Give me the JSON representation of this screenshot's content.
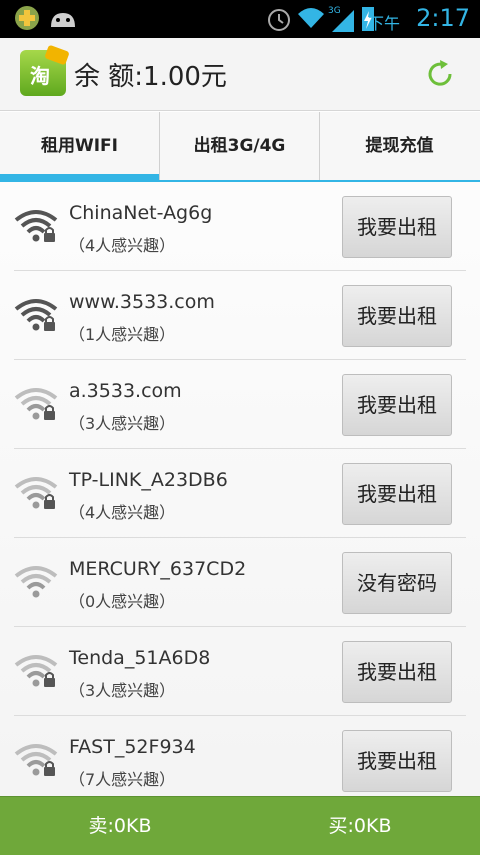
{
  "status_bar": {
    "ampm": "下午",
    "time": "2:17",
    "icons": [
      "app-plus-icon",
      "android-icon",
      "alarm-icon",
      "wifi-icon",
      "3g-signal-icon",
      "battery-charging-icon"
    ]
  },
  "header": {
    "logo_char": "淘",
    "balance": "余 额:1.00元",
    "refresh_icon": "refresh-icon"
  },
  "tabs": [
    {
      "label": "租用WIFI",
      "selected": true
    },
    {
      "label": "出租3G/4G",
      "selected": false
    },
    {
      "label": "提现充值",
      "selected": false
    }
  ],
  "networks": [
    {
      "ssid": "ChinaNet-Ag6g",
      "interest": "（4人感兴趣）",
      "button": "我要出租",
      "signal": "strong",
      "locked": true
    },
    {
      "ssid": "www.3533.com",
      "interest": "（1人感兴趣）",
      "button": "我要出租",
      "signal": "strong",
      "locked": true
    },
    {
      "ssid": "a.3533.com",
      "interest": "（3人感兴趣）",
      "button": "我要出租",
      "signal": "weak",
      "locked": true
    },
    {
      "ssid": "TP-LINK_A23DB6",
      "interest": "（4人感兴趣）",
      "button": "我要出租",
      "signal": "weak",
      "locked": true
    },
    {
      "ssid": "MERCURY_637CD2",
      "interest": "（0人感兴趣）",
      "button": "没有密码",
      "signal": "weak",
      "locked": false
    },
    {
      "ssid": "Tenda_51A6D8",
      "interest": "（3人感兴趣）",
      "button": "我要出租",
      "signal": "weak",
      "locked": true
    },
    {
      "ssid": "FAST_52F934",
      "interest": "（7人感兴趣）",
      "button": "我要出租",
      "signal": "weak",
      "locked": true
    }
  ],
  "bottom_bar": {
    "sell": "卖:0KB",
    "buy": "买:0KB"
  },
  "colors": {
    "accent": "#33b5e5",
    "bottom_bar": "#6fa83a",
    "refresh": "#6dbf3a"
  }
}
